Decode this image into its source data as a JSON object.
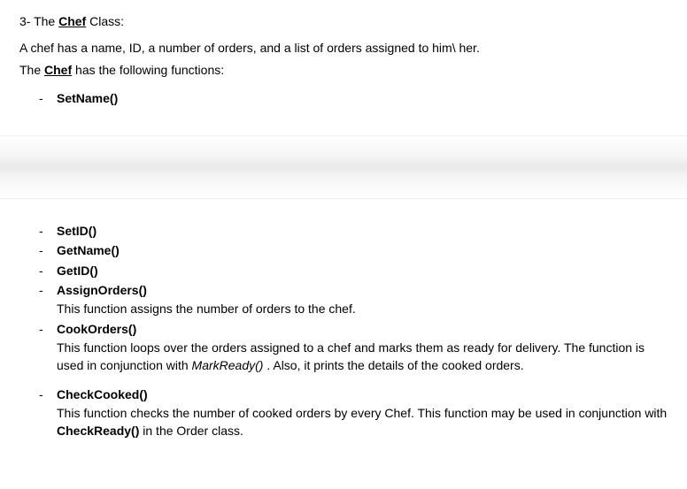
{
  "heading": {
    "number_prefix": "3-",
    "word_the": "The",
    "class_name": "Chef",
    "word_class": "Class:"
  },
  "intro": {
    "line1": "A chef has a name, ID, a number of orders, and a list of orders assigned to him\\ her.",
    "line2_pre": "The",
    "line2_class": "Chef",
    "line2_post": "has the following functions:"
  },
  "top_list": {
    "items": [
      {
        "name": "SetName()"
      }
    ]
  },
  "bottom_list": {
    "items": [
      {
        "name": "SetID()",
        "desc_plain": ""
      },
      {
        "name": "GetName()",
        "desc_plain": ""
      },
      {
        "name": "GetID()",
        "desc_plain": ""
      },
      {
        "name": "AssignOrders()",
        "desc_plain": "This function assigns the number of orders to the chef."
      },
      {
        "name": "CookOrders()",
        "desc_pre": "This function loops over the orders assigned to a chef and marks them as ready for delivery. The function is used in conjunction with ",
        "desc_italic": "MarkReady()",
        "desc_post": " . Also, it prints the details of the cooked orders."
      },
      {
        "name": "CheckCooked()",
        "desc_pre": "This function checks the number of cooked orders by every Chef. This function may be used in conjunction with ",
        "desc_bold": "CheckReady()",
        "desc_post": " in the Order class."
      }
    ]
  }
}
